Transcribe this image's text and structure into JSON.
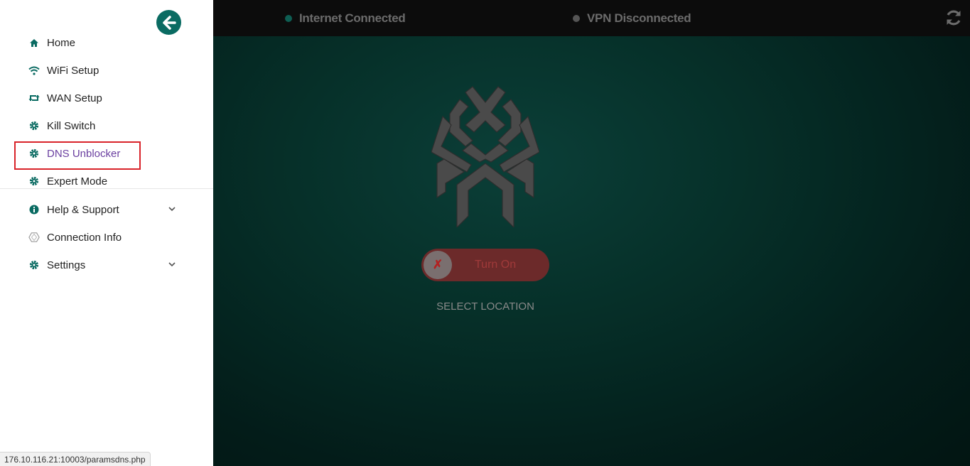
{
  "sidebar": {
    "items": [
      {
        "label": "Home",
        "icon": "home-icon"
      },
      {
        "label": "WiFi Setup",
        "icon": "wifi-icon"
      },
      {
        "label": "WAN Setup",
        "icon": "retweet-icon"
      },
      {
        "label": "Kill Switch",
        "icon": "gear-icon"
      },
      {
        "label": "DNS Unblocker",
        "icon": "gear-icon"
      },
      {
        "label": "Expert Mode",
        "icon": "gear-icon"
      },
      {
        "label": "Help & Support",
        "icon": "info-circle-icon"
      },
      {
        "label": "Connection Info",
        "icon": "hexagon-icon"
      },
      {
        "label": "Settings",
        "icon": "gear-icon"
      }
    ]
  },
  "topbar": {
    "internet_status": "Internet Connected",
    "vpn_status": "VPN Disconnected"
  },
  "vpn_toggle": {
    "state_symbol": "✗",
    "label": "Turn On"
  },
  "select_location": "SELECT LOCATION",
  "status_url": "176.10.116.21:10003/paramsdns.php",
  "colors": {
    "accent": "#0a6b62",
    "active_item": "#6a3fa0",
    "highlight_border": "#d9232a",
    "internet_dot": "#0e5e53",
    "vpn_dot": "#555555",
    "toggle_bg": "#6c2a2a"
  }
}
